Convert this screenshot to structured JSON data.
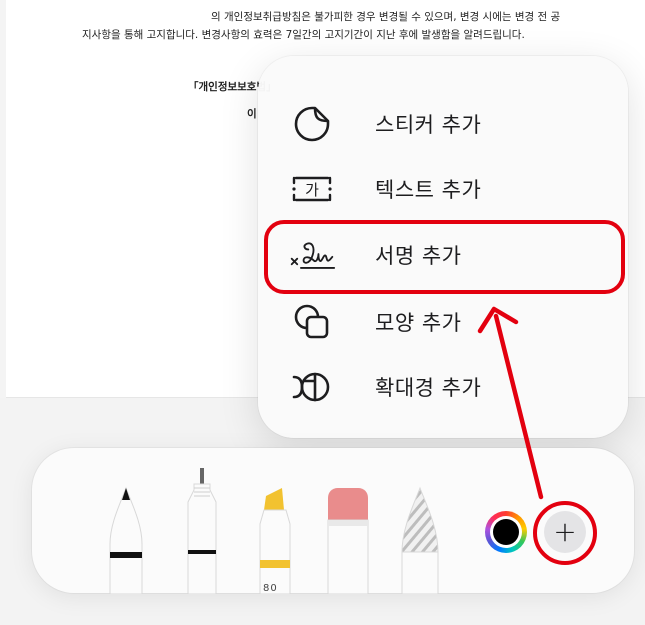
{
  "document": {
    "line1": "의 개인정보취급방침은 불가피한 경우 변경될 수 있으며, 변경 시에는 변경 전 공",
    "line2": "지사항을 통해 고지합니다. 변경사항의 효력은 7일간의 고지기간이 지난 후에 발생함을 알려드립니다.",
    "line3": "「개인정보보호법」",
    "line4": "이"
  },
  "menu": {
    "items": [
      {
        "label": "스티커 추가",
        "icon": "sticker-icon"
      },
      {
        "label": "텍스트 추가",
        "icon": "text-box-icon",
        "icon_text": "가"
      },
      {
        "label": "서명 추가",
        "icon": "signature-icon"
      },
      {
        "label": "모양 추가",
        "icon": "shapes-icon"
      },
      {
        "label": "확대경 추가",
        "icon": "magnifier-icon"
      }
    ],
    "highlighted_index": 2
  },
  "toolbar": {
    "tools": [
      "pen-icon",
      "fineliner-icon",
      "highlighter-icon",
      "eraser-icon",
      "pencil-icon"
    ],
    "highlighter_label": "80",
    "selected_color": "#000000",
    "add_button_label": "+"
  },
  "colors": {
    "annotation_red": "#e3000f",
    "highlighter_yellow": "#f2c230",
    "eraser_pink": "#e98c8c"
  }
}
